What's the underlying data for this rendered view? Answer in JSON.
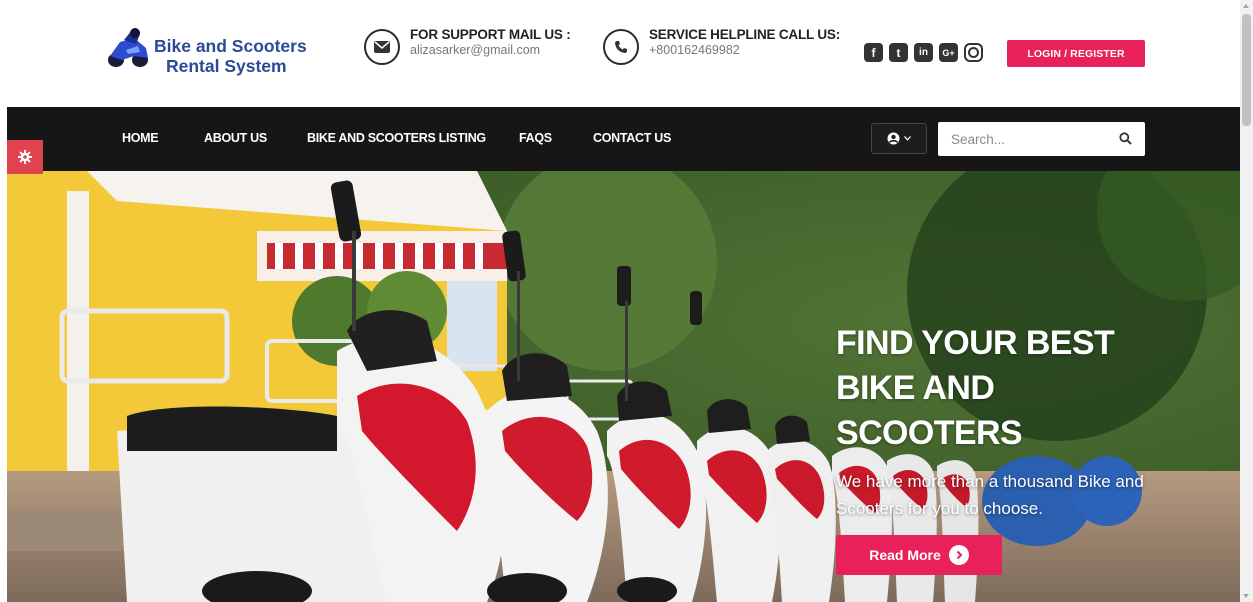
{
  "header": {
    "logo_line1": "Bike and Scooters",
    "logo_line2": "Rental System",
    "support_title": "FOR SUPPORT MAIL US :",
    "support_email": "alizasarker@gmail.com",
    "helpline_title": "SERVICE HELPLINE CALL US:",
    "helpline_phone": "+800162469982",
    "socials": [
      {
        "name": "facebook-icon",
        "glyph": "f"
      },
      {
        "name": "twitter-icon",
        "glyph": "t"
      },
      {
        "name": "linkedin-icon",
        "glyph": "in"
      },
      {
        "name": "google-plus-icon",
        "glyph": "G+"
      },
      {
        "name": "instagram-icon",
        "glyph": ""
      }
    ],
    "login_label": "LOGIN / REGISTER"
  },
  "nav": {
    "items": [
      {
        "label": "HOME"
      },
      {
        "label": "ABOUT US"
      },
      {
        "label": "BIKE AND SCOOTERS LISTING"
      },
      {
        "label": "FAQS"
      },
      {
        "label": "CONTACT US"
      }
    ],
    "search_placeholder": "Search..."
  },
  "hero": {
    "title": "FIND YOUR BEST BIKE AND SCOOTERS",
    "subtitle": "We have more than a thousand Bike and Scooters for you to choose.",
    "button_label": "Read More"
  },
  "colors": {
    "accent": "#e8215b",
    "nav_bg": "#161616",
    "logo_blue": "#2b4a9a",
    "gear_bg": "#e0434f"
  }
}
